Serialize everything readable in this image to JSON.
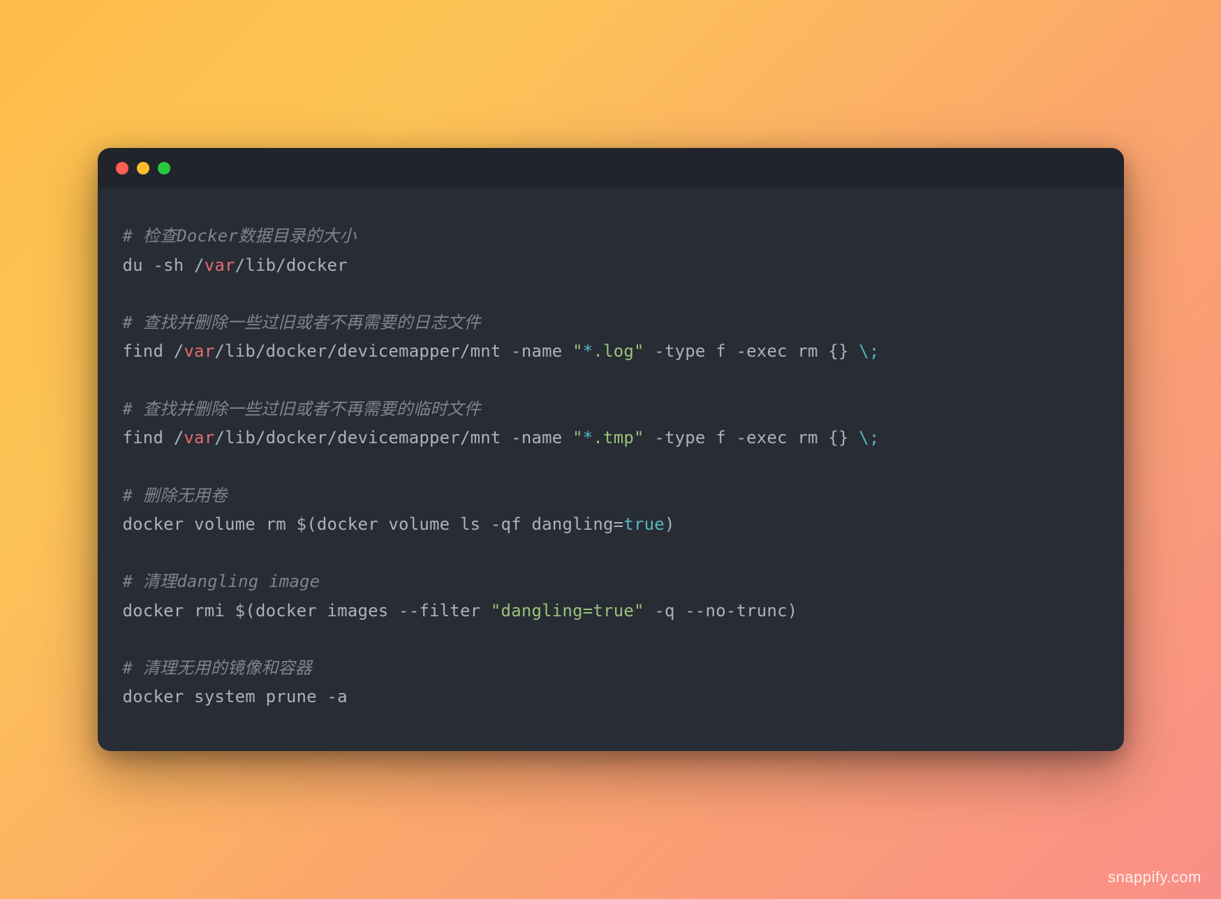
{
  "window": {
    "traffic_lights": [
      "red",
      "yellow",
      "green"
    ]
  },
  "code": {
    "comment1": "# 检查Docker数据目录的大小",
    "l2_a": "du -sh /",
    "l2_var": "var",
    "l2_b": "/lib/docker",
    "comment2": "# 查找并删除一些过旧或者不再需要的日志文件",
    "l4_a": "find /",
    "l4_var": "var",
    "l4_b": "/lib/docker/devicemapper/mnt -name ",
    "l4_sq1": "\"",
    "l4_star": "*",
    "l4_sq2": ".log\"",
    "l4_c": " -type f -exec rm {} ",
    "l4_esc": "\\;",
    "comment3": "# 查找并删除一些过旧或者不再需要的临时文件",
    "l6_a": "find /",
    "l6_var": "var",
    "l6_b": "/lib/docker/devicemapper/mnt -name ",
    "l6_sq1": "\"",
    "l6_star": "*",
    "l6_sq2": ".tmp\"",
    "l6_c": " -type f -exec rm {} ",
    "l6_esc": "\\;",
    "comment4": "# 删除无用卷",
    "l8_a": "docker volume rm ",
    "l8_p1": "$(",
    "l8_b": "docker volume ls -qf dangling=",
    "l8_true": "true",
    "l8_p2": ")",
    "comment5": "# 清理dangling image",
    "l10_a": "docker rmi ",
    "l10_p1": "$(",
    "l10_b": "docker images --filter ",
    "l10_str": "\"dangling=true\"",
    "l10_c": " -q --no-trunc",
    "l10_p2": ")",
    "comment6": "# 清理无用的镜像和容器",
    "l12_a": "docker system prune -a"
  },
  "watermark": "snappify.com"
}
